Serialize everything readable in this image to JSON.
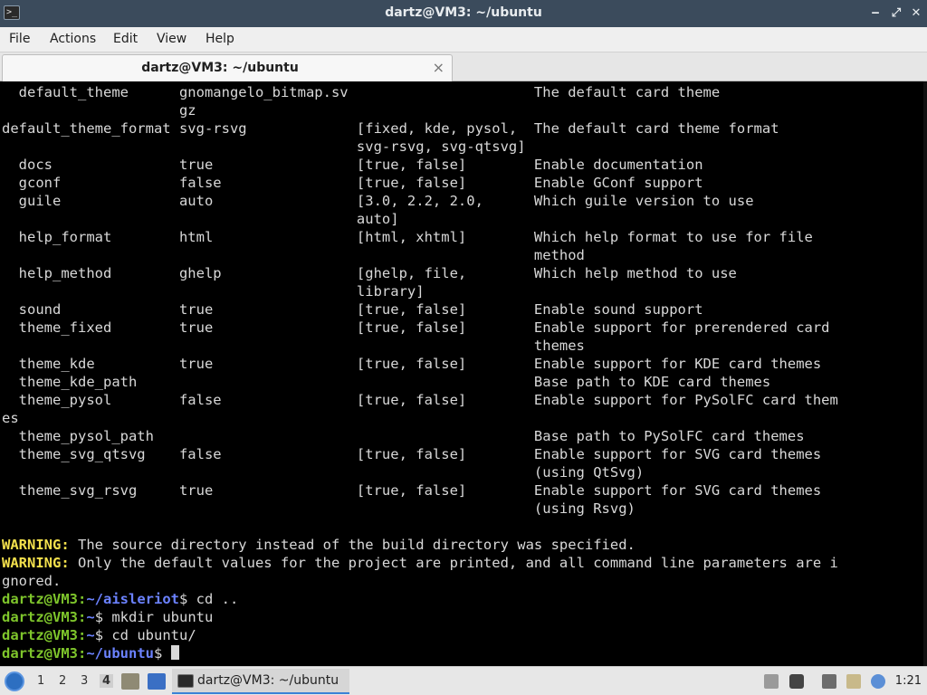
{
  "window": {
    "title": "dartz@VM3: ~/ubuntu",
    "minimize": "‒",
    "maximize": "⤢",
    "close": "✕"
  },
  "menu": [
    "File",
    "Actions",
    "Edit",
    "View",
    "Help"
  ],
  "tab": {
    "label": "dartz@VM3: ~/ubuntu",
    "close": "×"
  },
  "terminal": {
    "lines": [
      "  default_theme      gnomangelo_bitmap.sv                      The default card theme",
      "                     gz",
      "default_theme_format svg-rsvg             [fixed, kde, pysol,  The default card theme format",
      "                                          svg-rsvg, svg-qtsvg]",
      "  docs               true                 [true, false]        Enable documentation",
      "  gconf              false                [true, false]        Enable GConf support",
      "  guile              auto                 [3.0, 2.2, 2.0,      Which guile version to use",
      "                                          auto]",
      "  help_format        html                 [html, xhtml]        Which help format to use for file",
      "                                                               method",
      "  help_method        ghelp                [ghelp, file,        Which help method to use",
      "                                          library]",
      "  sound              true                 [true, false]        Enable sound support",
      "  theme_fixed        true                 [true, false]        Enable support for prerendered card",
      "                                                               themes",
      "  theme_kde          true                 [true, false]        Enable support for KDE card themes",
      "  theme_kde_path                                               Base path to KDE card themes",
      "  theme_pysol        false                [true, false]        Enable support for PySolFC card them",
      "es",
      "  theme_pysol_path                                             Base path to PySolFC card themes",
      "  theme_svg_qtsvg    false                [true, false]        Enable support for SVG card themes",
      "                                                               (using QtSvg)",
      "  theme_svg_rsvg     true                 [true, false]        Enable support for SVG card themes",
      "                                                               (using Rsvg)",
      ""
    ],
    "warnings": [
      {
        "tag": "WARNING:",
        "text": " The source directory instead of the build directory was specified."
      },
      {
        "tag": "WARNING:",
        "text": " Only the default values for the project are printed, and all command line parameters are i"
      }
    ],
    "wrap_line": "gnored.",
    "prompts": [
      {
        "user": "dartz@VM3",
        "sep": ":",
        "path": "~/aisleriot",
        "cmd": "$ cd .."
      },
      {
        "user": "dartz@VM3",
        "sep": ":",
        "path": "~",
        "cmd": "$ mkdir ubuntu"
      },
      {
        "user": "dartz@VM3",
        "sep": ":",
        "path": "~",
        "cmd": "$ cd ubuntu/"
      },
      {
        "user": "dartz@VM3",
        "sep": ":",
        "path": "~/ubuntu",
        "cmd": "$ "
      }
    ]
  },
  "taskbar": {
    "workspaces": [
      "1",
      "2",
      "3",
      "4"
    ],
    "active_workspace": "4",
    "task_label": "dartz@VM3: ~/ubuntu",
    "clock": "1:21",
    "icons": [
      "start-menu-icon",
      "file-manager-icon",
      "show-desktop-icon",
      "terminal-icon",
      "eject-icon",
      "volume-icon",
      "network-icon",
      "clipboard-icon",
      "updates-icon"
    ]
  },
  "colors": {
    "titlebar": "#3b4b5c",
    "prompt_user": "#7ec52b",
    "prompt_path": "#6b82ff",
    "warning": "#f3e04c"
  }
}
